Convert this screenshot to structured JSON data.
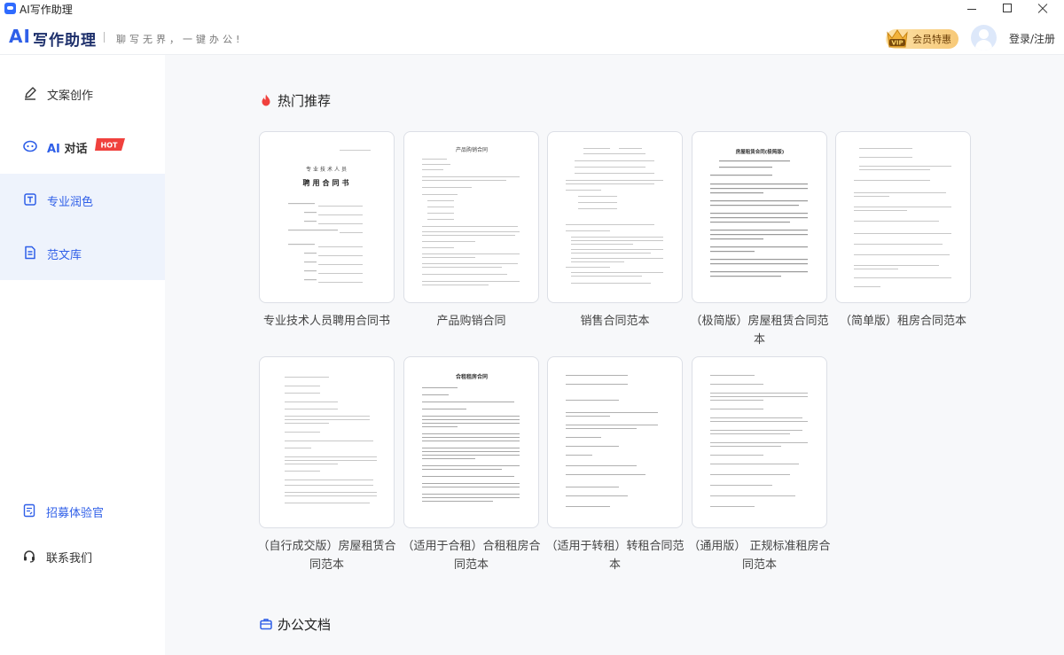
{
  "window": {
    "title": "AI写作助理",
    "controls": {
      "minimize": "minimize",
      "maximize": "maximize",
      "close": "close"
    }
  },
  "header": {
    "logo_ai": "AI",
    "logo_text": "写作助理",
    "slogan": "聊写无界，一键办公!",
    "vip_badge": "VIP",
    "vip_label": "会员特惠",
    "login": "登录/注册"
  },
  "sidebar": {
    "items": [
      {
        "label": "文案创作",
        "icon": "pen-icon"
      },
      {
        "label_ai": "AI",
        "label": "对话",
        "badge": "HOT",
        "icon": "chat-bubble-icon"
      },
      {
        "label": "专业润色",
        "icon": "text-box-icon",
        "active": true
      },
      {
        "label": "范文库",
        "icon": "document-icon",
        "active": true
      }
    ],
    "bottom": [
      {
        "label": "招募体验官",
        "icon": "recruit-form-icon"
      },
      {
        "label": "联系我们",
        "icon": "headset-icon"
      }
    ]
  },
  "main": {
    "hot_section": {
      "title": "热门推荐",
      "icon": "fire-icon"
    },
    "office_section": {
      "title": "办公文档",
      "icon": "briefcase-icon"
    },
    "cards": [
      {
        "caption": "专业技术人员聘用合同书",
        "doc_title": "专业技术人员\n聘用合同书"
      },
      {
        "caption": "产品购销合同",
        "doc_title": "产品购销合同"
      },
      {
        "caption": "销售合同范本",
        "doc_title": ""
      },
      {
        "caption": "（极简版）房屋租赁合同范本",
        "doc_title": "房屋租赁合同(极简版)"
      },
      {
        "caption": "（简单版）租房合同范本",
        "doc_title": ""
      },
      {
        "caption": "（自行成交版）房屋租赁合同范本",
        "doc_title": ""
      },
      {
        "caption": "（适用于合租）合租租房合同范本",
        "doc_title": "合租租房合同"
      },
      {
        "caption": "（适用于转租）转租合同范本",
        "doc_title": ""
      },
      {
        "caption": "（通用版） 正规标准租房合同范本",
        "doc_title": ""
      }
    ]
  },
  "colors": {
    "brand_blue": "#2f5fe8",
    "hot_red": "#f0413d",
    "vip_gold": "#f7c978",
    "active_bg": "#eef3fc"
  }
}
